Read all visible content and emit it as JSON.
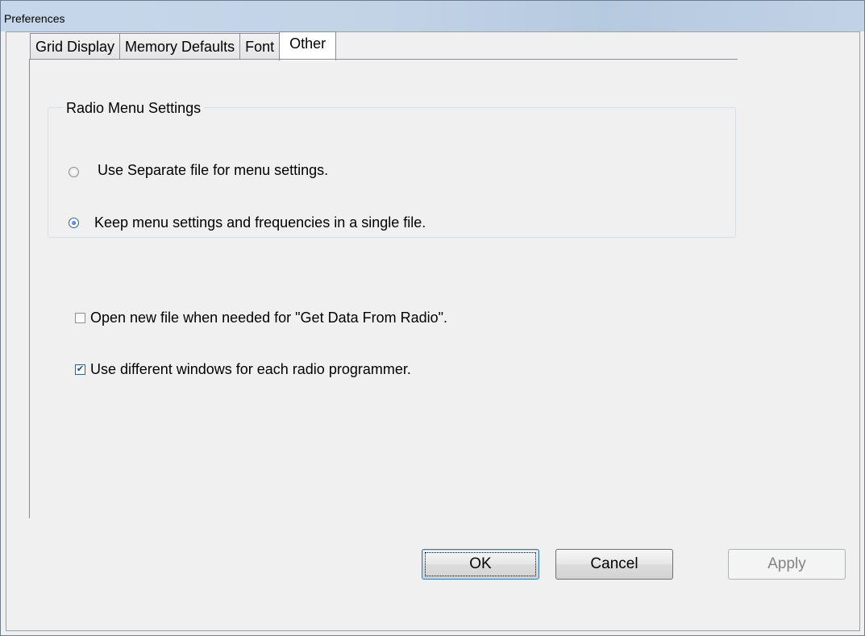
{
  "window": {
    "title": "Preferences"
  },
  "tabs": [
    {
      "label": "Grid Display",
      "active": false
    },
    {
      "label": "Memory Defaults",
      "active": false
    },
    {
      "label": "Font",
      "active": false
    },
    {
      "label": "Other",
      "active": true
    }
  ],
  "radio_group": {
    "legend": "Radio Menu Settings",
    "options": [
      {
        "label": "Use Separate file for menu settings.",
        "selected": false
      },
      {
        "label": "Keep menu settings and frequencies in a single file.",
        "selected": true
      }
    ]
  },
  "checkboxes": [
    {
      "label": "Open new file when needed for \"Get Data From Radio\".",
      "checked": false
    },
    {
      "label": "Use different windows for each radio programmer.",
      "checked": true
    }
  ],
  "buttons": {
    "ok": "OK",
    "cancel": "Cancel",
    "apply": "Apply"
  },
  "icons": {
    "checkmark": "✔"
  }
}
